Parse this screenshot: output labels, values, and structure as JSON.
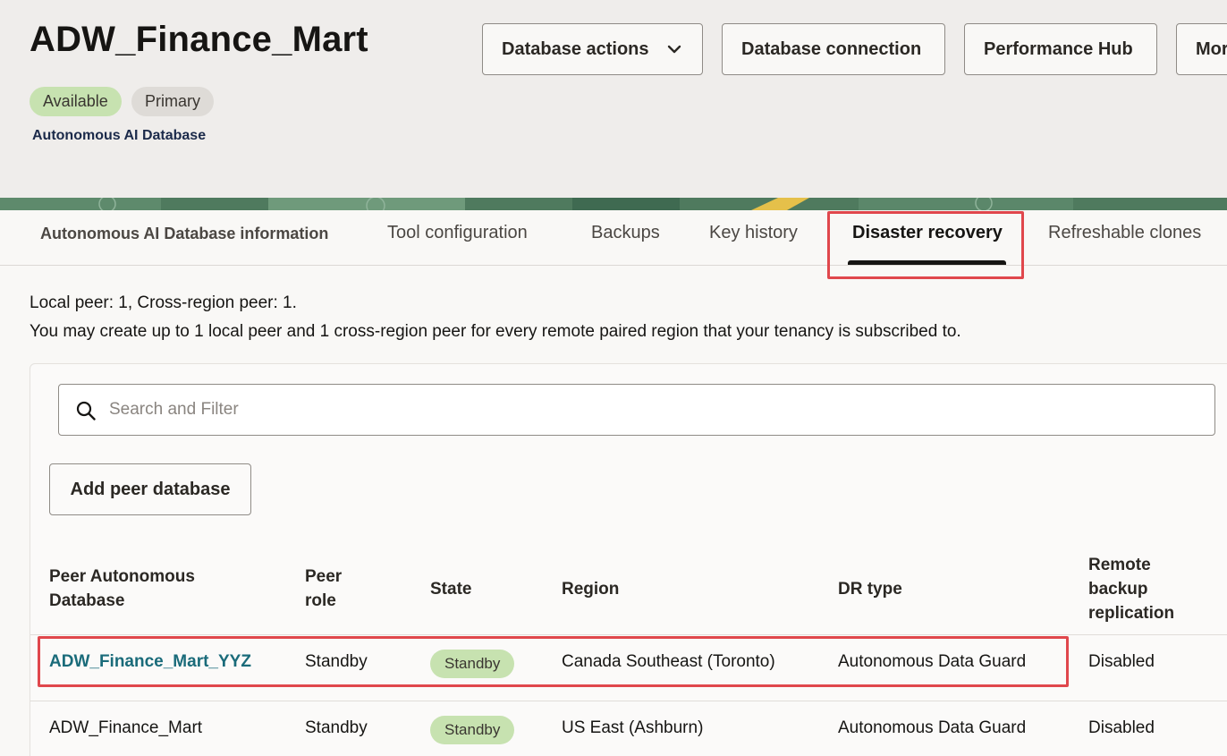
{
  "header": {
    "title": "ADW_Finance_Mart",
    "badges": {
      "available": "Available",
      "primary": "Primary"
    },
    "subtitle": "Autonomous AI Database",
    "buttons": {
      "database_actions": "Database actions",
      "database_connection": "Database connection",
      "performance_hub": "Performance Hub",
      "more": "More"
    }
  },
  "tabs": [
    {
      "label": "Autonomous AI Database information"
    },
    {
      "label": "Tool configuration"
    },
    {
      "label": "Backups"
    },
    {
      "label": "Key history"
    },
    {
      "label": "Disaster recovery",
      "active": true
    },
    {
      "label": "Refreshable clones"
    }
  ],
  "info": {
    "line1": "Local peer: 1, Cross-region peer: 1.",
    "line2": "You may create up to 1 local peer and 1 cross-region peer for every remote paired region that your tenancy is subscribed to."
  },
  "search": {
    "placeholder": "Search and Filter",
    "value": ""
  },
  "add_peer_button": "Add peer database",
  "table": {
    "columns": {
      "peer_db": {
        "line1": "Peer Autonomous",
        "line2": "Database"
      },
      "peer_role": {
        "line1": "Peer",
        "line2": "role"
      },
      "state": "State",
      "region": "Region",
      "dr_type": "DR type",
      "remote_backup": {
        "line1": "Remote",
        "line2": "backup",
        "line3": "replication"
      }
    },
    "rows": [
      {
        "peer_db": "ADW_Finance_Mart_YYZ",
        "peer_role": "Standby",
        "state": "Standby",
        "region": "Canada Southeast (Toronto)",
        "dr_type": "Autonomous Data Guard",
        "remote_backup": "Disabled",
        "is_link": true
      },
      {
        "peer_db": "ADW_Finance_Mart",
        "peer_role": "Standby",
        "state": "Standby",
        "region": "US East (Ashburn)",
        "dr_type": "Autonomous Data Guard",
        "remote_backup": "Disabled",
        "is_link": false
      }
    ]
  },
  "colors": {
    "available_badge": "#c7e2b0",
    "primary_badge": "#dedbd7",
    "highlight": "#e0474c",
    "link": "#1a6b7a"
  }
}
